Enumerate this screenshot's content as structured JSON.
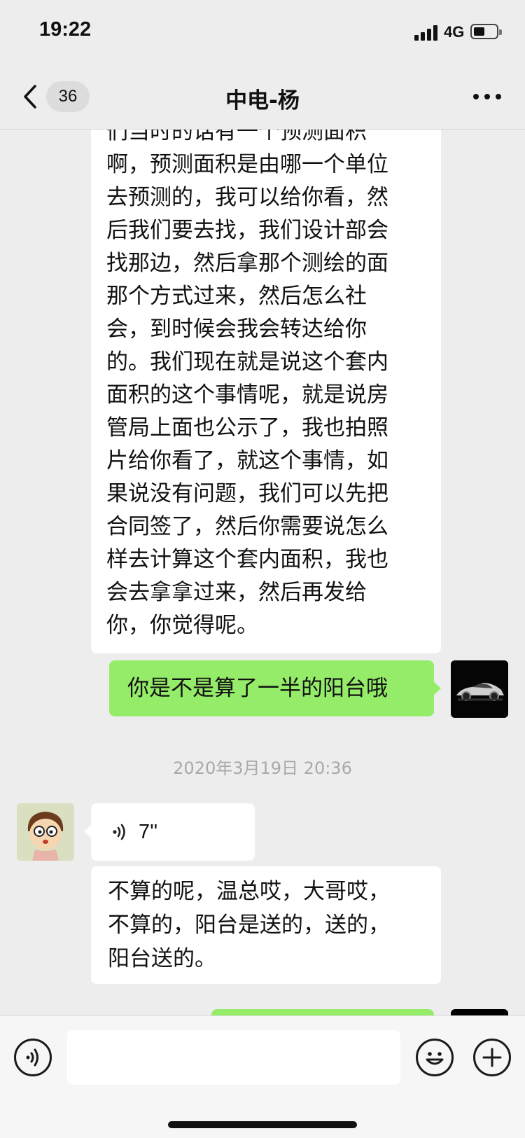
{
  "status_bar": {
    "time": "19:22",
    "network": "4G"
  },
  "nav": {
    "unread_count": "36",
    "title": "中电-杨"
  },
  "messages": {
    "incoming_long_lines": [
      "们当时的话有一个预测面积",
      "啊，预测面积是由哪一个单位",
      "去预测的，我可以给你看，然",
      "后我们要去找，我们设计部会",
      "找那边，然后拿那个测绘的面",
      "那个方式过来，然后怎么社",
      "会，到时候会我会转达给你",
      "的。我们现在就是说这个套内",
      "面积的这个事情呢，就是说房",
      "管局上面也公示了，我也拍照",
      "片给你看了，就这个事情，如",
      "果说没有问题，我们可以先把",
      "合同签了，然后你需要说怎么",
      "样去计算这个套内面积，我也",
      "会去拿拿过来，然后再发给",
      "你，你觉得呢。"
    ],
    "outgoing_text": "你是不是算了一半的阳台哦",
    "timestamp": "2020年3月19日 20:36",
    "voice_duration": "7''",
    "incoming_reply_lines": [
      "不算的呢，温总哎，大哥哎，",
      "不算的，阳台是送的，送的，",
      "阳台送的。"
    ]
  },
  "input": {
    "placeholder": ""
  },
  "icons": {
    "back": "chevron-left-icon",
    "more": "more-dots-icon",
    "voice_message": "voice-wave-icon",
    "voice_input": "voice-input-icon",
    "emoji": "emoji-icon",
    "plus": "plus-icon"
  },
  "colors": {
    "background": "#ededed",
    "outgoing_bubble": "#95ec69",
    "incoming_bubble": "#ffffff",
    "timestamp": "#a9a9a9"
  }
}
